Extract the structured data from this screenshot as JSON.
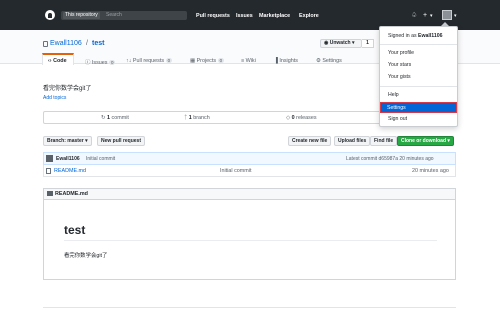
{
  "header": {
    "search_scope": "This repository",
    "search_placeholder": "Search",
    "nav": [
      "Pull requests",
      "Issues",
      "Marketplace",
      "Explore"
    ],
    "bell_icon": "bell-icon",
    "plus_label": "+",
    "plus_caret": "▾",
    "avatar_caret": "▾"
  },
  "repo": {
    "owner": "Ewall1106",
    "separator": "/",
    "name": "test",
    "unwatch_label": "◉ Unwatch ▾",
    "watch_count": "1"
  },
  "tabs": [
    {
      "label": "‹› Code"
    },
    {
      "label": "ⓘ Issues",
      "count": "0"
    },
    {
      "label": "↑↓ Pull requests",
      "count": "0"
    },
    {
      "label": "▦ Projects",
      "count": "0"
    },
    {
      "label": "≡ Wiki"
    },
    {
      "label": "▐ Insights"
    },
    {
      "label": "⚙ Settings"
    }
  ],
  "description": "看完你数学会git了",
  "add_topics": "Add topics",
  "summary": {
    "commits_num": "1",
    "commits_label": "commit",
    "branches_num": "1",
    "branches_label": "branch",
    "releases_num": "0",
    "releases_label": "releases"
  },
  "file_nav": {
    "branch_btn": "Branch: master ▾",
    "new_pr": "New pull request",
    "create_file": "Create new file",
    "upload": "Upload files",
    "find": "Find file",
    "clone": "Clone or download ▾"
  },
  "commit": {
    "author": "Ewall1106",
    "message": "Initial commit",
    "latest": "Latest commit d65987a 20 minutes ago"
  },
  "files": [
    {
      "name": "README.md",
      "message": "Initial commit",
      "age": "20 minutes ago"
    }
  ],
  "readme": {
    "label": "README.md",
    "heading": "test",
    "body": "看完你数学会git了"
  },
  "dropdown": {
    "signed_in_prefix": "Signed in as",
    "signed_in_user": "Ewall1106",
    "items": [
      "Your profile",
      "Your stars",
      "Your gists",
      "Help",
      "Settings",
      "Sign out"
    ]
  },
  "colors": {
    "header_bg": "#24292e",
    "link": "#0366d6",
    "selected_tab_accent": "#e36209",
    "highlight_outline": "#d73a49",
    "clone_button": "#28a745"
  }
}
